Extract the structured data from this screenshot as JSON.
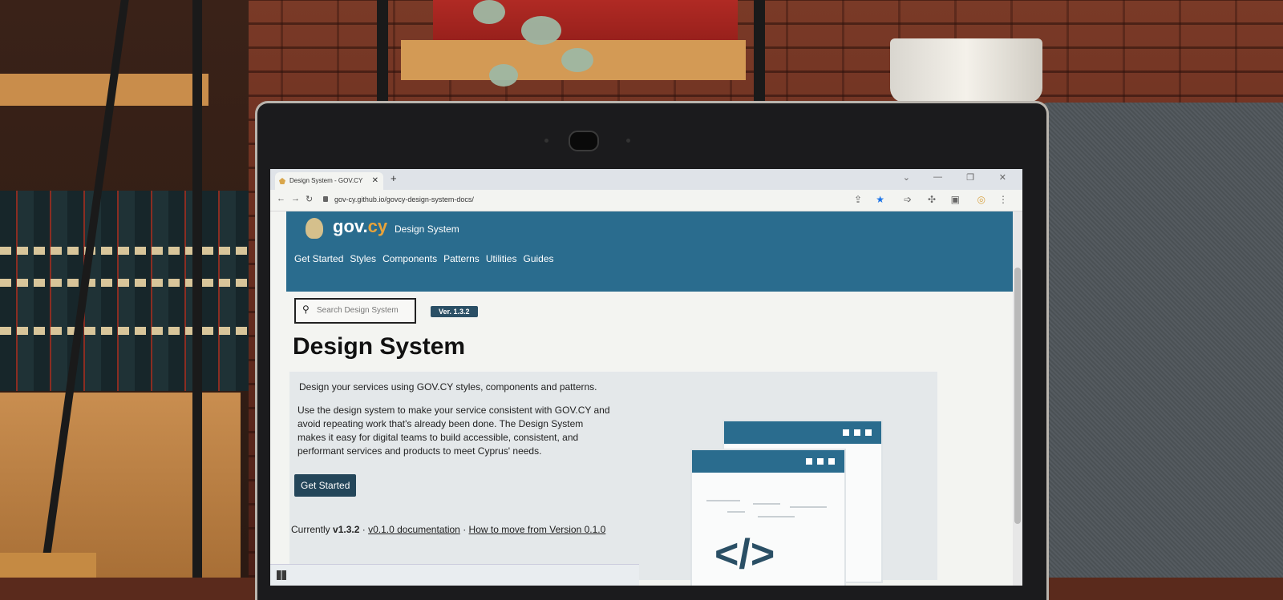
{
  "browser": {
    "tab_title": "Design System - GOV.CY",
    "tab_close": "✕",
    "new_tab": "+",
    "url": "gov-cy.github.io/govcy-design-system-docs/"
  },
  "site": {
    "logo_text_1": "gov.",
    "logo_text_2": "cy",
    "name": "Design System",
    "nav": [
      "Get Started",
      "Styles",
      "Components",
      "Patterns",
      "Utilities",
      "Guides"
    ],
    "search_placeholder": "Search Design System",
    "version_badge": "Ver. 1.3.2"
  },
  "content": {
    "heading": "Design System",
    "lead": "Design your services using GOV.CY styles, components and patterns.",
    "body": "Use the design system to make your service consistent with GOV.CY and avoid repeating work that's already been done. The Design System makes it easy for digital teams to build accessible, consistent, and performant services and products to meet Cyprus' needs.",
    "cta": "Get Started",
    "currently_label": "Currently",
    "current_version": "v1.3.2",
    "sep": "·",
    "old_docs_link": "v0.1.0 documentation",
    "migrate_link": "How to move from Version 0.1.0"
  },
  "icons": {
    "search": "search-icon",
    "code": "code-icon"
  },
  "colors": {
    "brand_blue": "#2a6c8e",
    "brand_dark": "#24465a",
    "logo_orange": "#e8a33a"
  }
}
